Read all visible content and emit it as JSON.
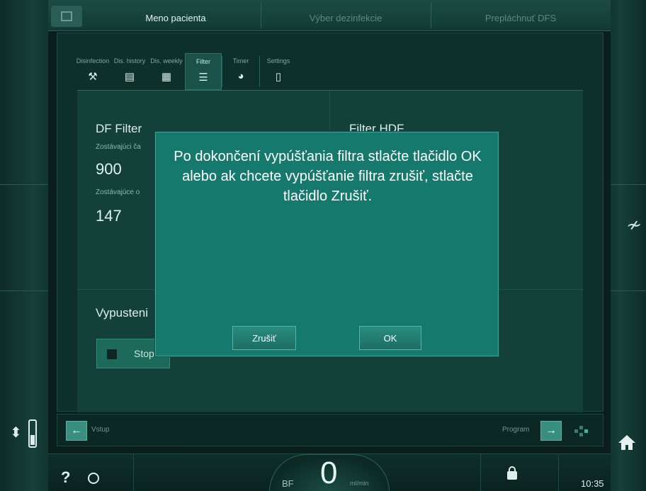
{
  "top_tabs": [
    {
      "label": "Meno pacienta",
      "state": "active"
    },
    {
      "label": "Výber dezinfekcie",
      "state": "dim"
    },
    {
      "label": "Prepláchnuť DFS",
      "state": "dim"
    }
  ],
  "sub_tabs": [
    {
      "label": "Disinfection",
      "icon": "wrench-icon"
    },
    {
      "label": "Dis. history",
      "icon": "history-icon"
    },
    {
      "label": "Dis. weekly",
      "icon": "weekly-icon"
    },
    {
      "label": "Filter",
      "icon": "filter-icon",
      "active": true
    },
    {
      "label": "Timer",
      "icon": "timer-icon"
    },
    {
      "label": "Settings",
      "icon": "settings-icon"
    }
  ],
  "df_filter": {
    "title": "DF Filter",
    "remaining_time_label": "Zostávajúci ča",
    "remaining_time_value": "900",
    "remaining_other_label": "Zostávajúce o",
    "remaining_other_value": "147"
  },
  "hdf_filter": {
    "title": "Filter HDF"
  },
  "drain": {
    "title": "Vypusteni",
    "stop_label": "Stop"
  },
  "modal": {
    "message": "Po dokončení vypúšťania filtra stlačte tlačidlo OK alebo ak chcete vypúšťanie filtra zrušiť, stlačte tlačidlo Zrušiť.",
    "cancel_label": "Zrušiť",
    "ok_label": "OK"
  },
  "nav": {
    "back_label": "Vstup",
    "forward_label": "Program"
  },
  "status": {
    "help_glyph": "?",
    "bf_label": "BF",
    "bf_value": "0",
    "bf_unit": "ml/min",
    "time": "10:35"
  }
}
